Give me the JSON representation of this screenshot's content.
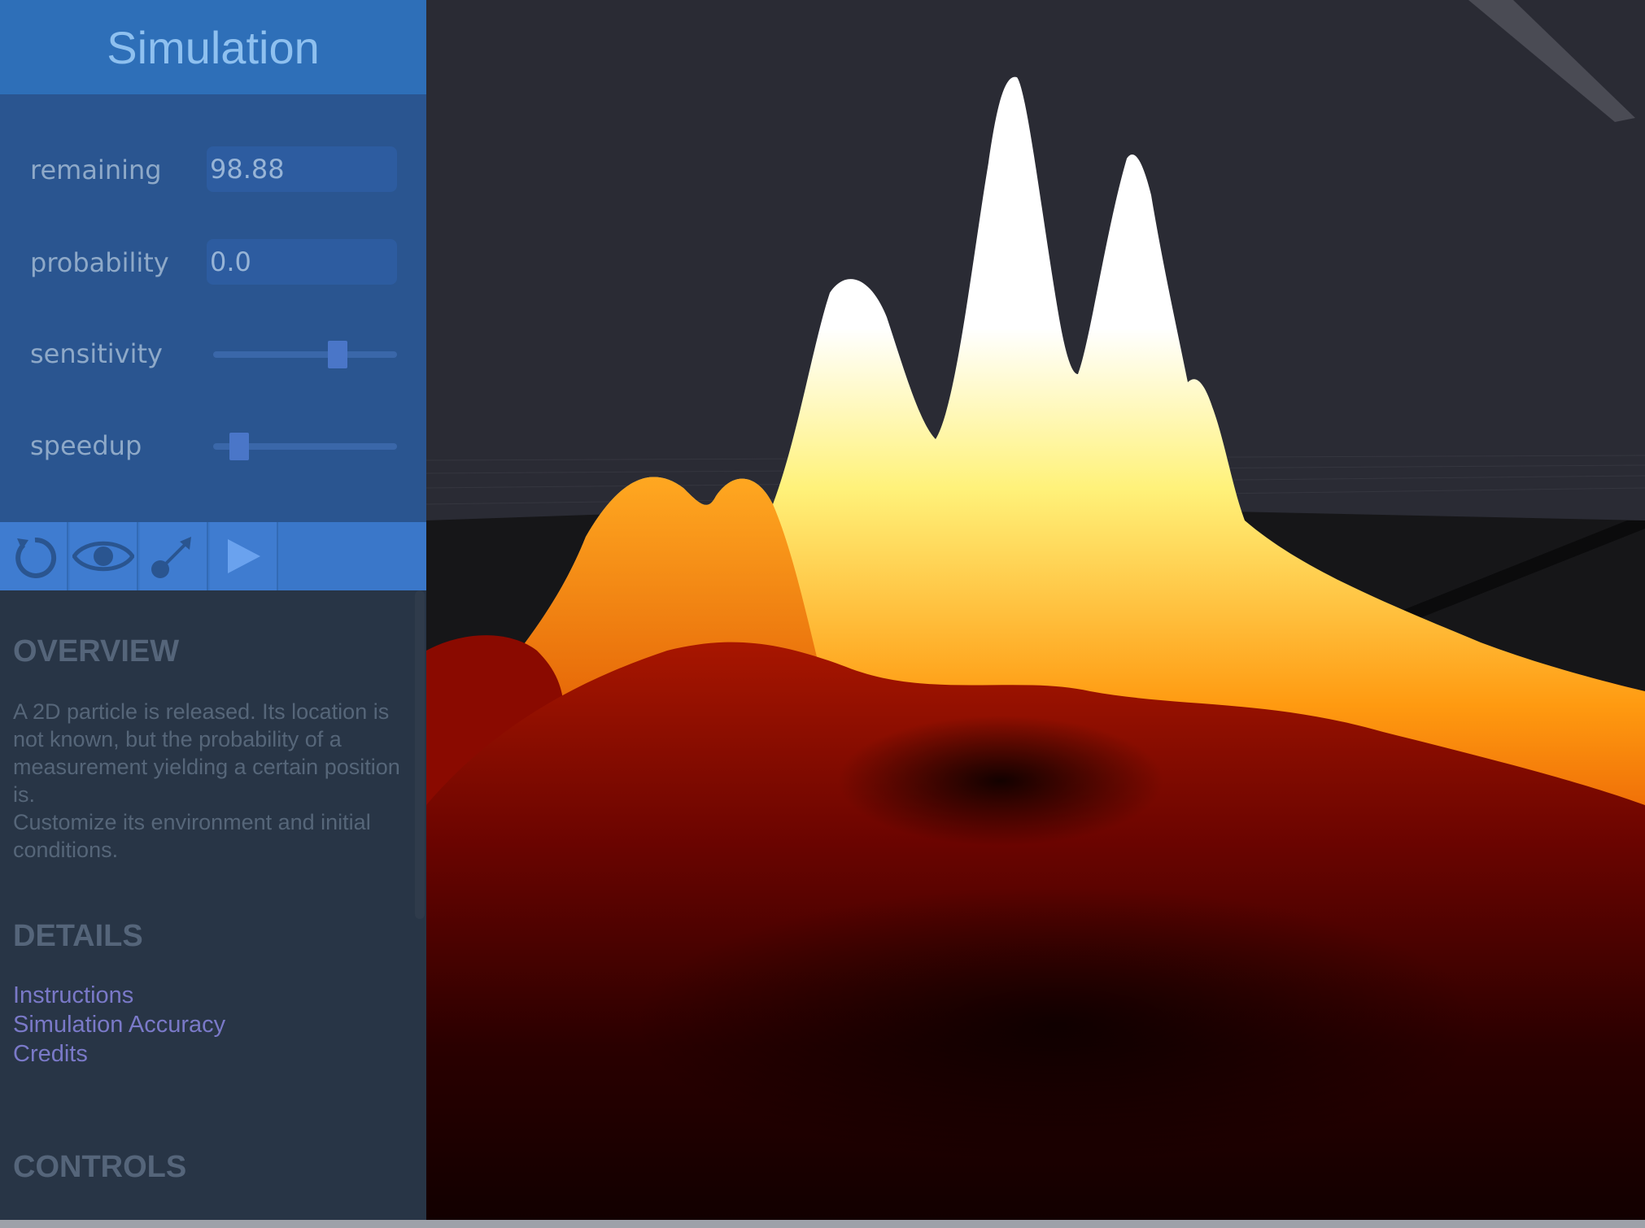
{
  "panel": {
    "title": "Simulation",
    "params": {
      "remaining": {
        "label": "remaining",
        "value": "98.88"
      },
      "probability": {
        "label": "probability",
        "value": "0.0"
      },
      "sensitivity": {
        "label": "sensitivity",
        "level": 0.7
      },
      "speedup": {
        "label": "speedup",
        "level": 0.1
      }
    },
    "toolbar": {
      "icons": [
        "reset-icon",
        "eye-icon",
        "vector-arrow-icon",
        "play-icon"
      ],
      "accent": "#3a77c9"
    },
    "overview": {
      "title": "OVERVIEW",
      "line1": "A 2D particle is released.  Its location is not known, but the probability of a measurement yielding a certain position is.",
      "line2": "Customize its environment and initial conditions."
    },
    "details": {
      "title": "DETAILS",
      "links": [
        "Instructions",
        "Simulation Accuracy",
        "Credits"
      ]
    },
    "controls": {
      "title": "CONTROLS"
    }
  },
  "colors": {
    "header": "#2e6fb8",
    "params_bg": "#2a5590",
    "info_bg": "#283546",
    "viewport_bg": "#2a2b34",
    "surface_low": "#1a0000",
    "surface_mid": "#8a0a00",
    "surface_high": "#ff8a10",
    "surface_peak": "#ffffff"
  }
}
